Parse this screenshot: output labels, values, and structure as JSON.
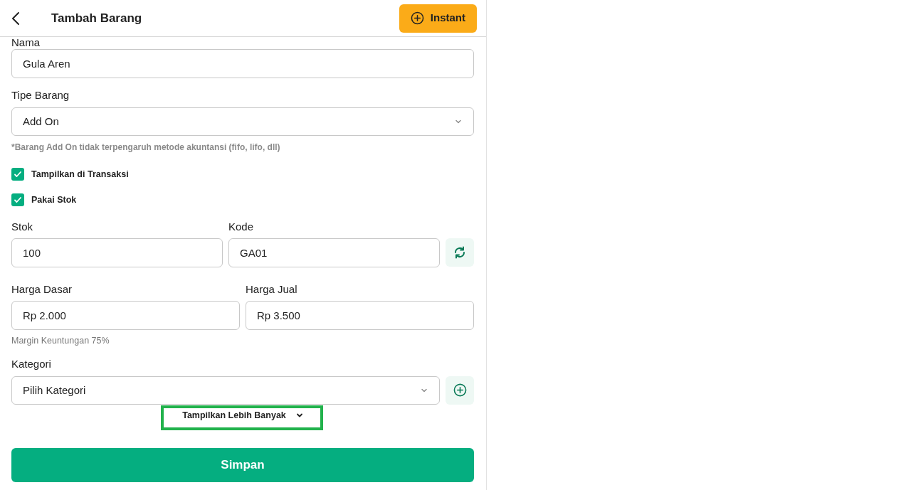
{
  "header": {
    "title": "Tambah Barang",
    "instant_button": "Instant"
  },
  "nama": {
    "label": "Nama",
    "value": "Gula Aren"
  },
  "tipe_barang": {
    "label": "Tipe Barang",
    "value": "Add On",
    "note": "*Barang Add On tidak terpengaruh metode akuntansi (fifo, lifo, dll)"
  },
  "checkboxes": [
    {
      "label": "Tampilkan di Transaksi",
      "checked": true
    },
    {
      "label": "Pakai Stok",
      "checked": true
    }
  ],
  "stok": {
    "label": "Stok",
    "value": "100"
  },
  "kode": {
    "label": "Kode",
    "value": "GA01"
  },
  "harga_dasar": {
    "label": "Harga Dasar",
    "value": "Rp 2.000"
  },
  "harga_jual": {
    "label": "Harga Jual",
    "value": "Rp 3.500"
  },
  "margin": "Margin Keuntungan 75%",
  "kategori": {
    "label": "Kategori",
    "placeholder": "Pilih Kategori"
  },
  "more_button": "Tampilkan Lebih Banyak",
  "save_button": "Simpan"
}
